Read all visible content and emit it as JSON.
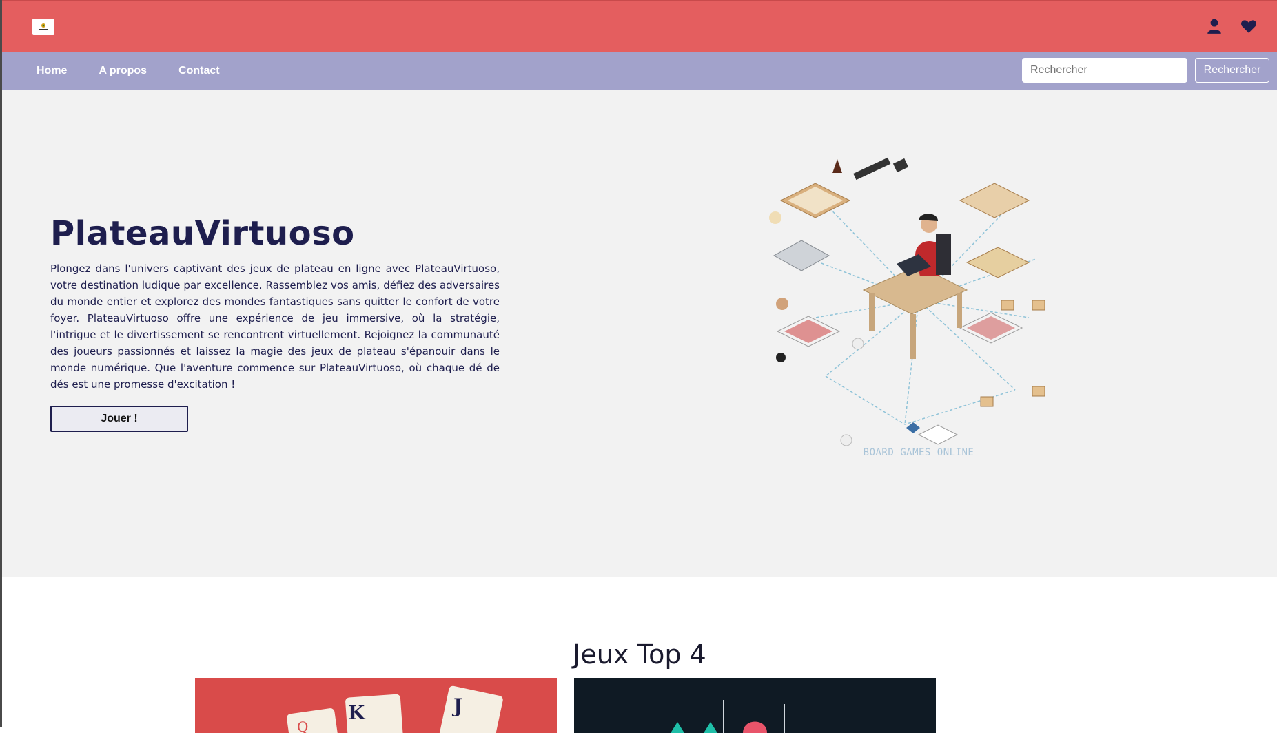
{
  "header": {
    "logo_name": "board-games-logo",
    "icons": [
      "user-icon",
      "heart-icon"
    ],
    "color": "#e45e5f"
  },
  "nav": {
    "links": [
      "Home",
      "A propos",
      "Contact"
    ],
    "search": {
      "placeholder": "Rechercher",
      "button_label": "Rechercher"
    },
    "color": "#a2a2cb"
  },
  "hero": {
    "title": "PlateauVirtuoso",
    "text": "Plongez dans l'univers captivant des jeux de plateau en ligne avec PlateauVirtuoso, votre destination ludique par excellence. Rassemblez vos amis, défiez des adversaires du monde entier et explorez des mondes fantastiques sans quitter le confort de votre foyer. PlateauVirtuoso offre une expérience de jeu immersive, où la stratégie, l'intrigue et le divertissement se rencontrent virtuellement. Rejoignez la communauté des joueurs passionnés et laissez la magie des jeux de plateau s'épanouir dans le monde numérique. Que l'aventure commence sur PlateauVirtuoso, où chaque dé de dés est une promesse d'excitation !",
    "play_button": "Jouer !",
    "illustration_caption": "BOARD GAMES ONLINE",
    "title_color": "#1e1e4e"
  },
  "top_games": {
    "title": "Jeux Top 4"
  }
}
